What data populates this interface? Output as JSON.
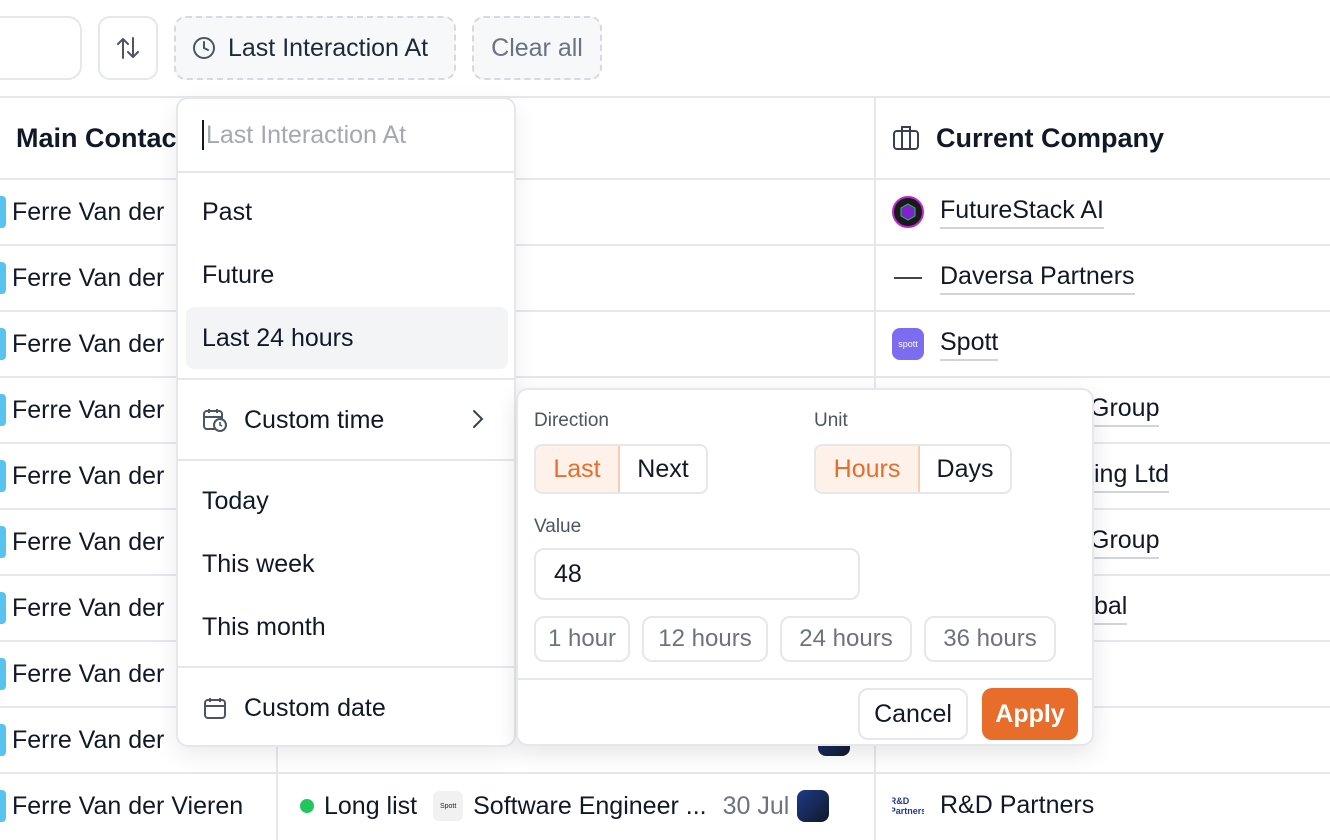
{
  "toolbar": {
    "sort_icon": "sort-arrows-icon",
    "filter_chip": {
      "icon": "clock-icon",
      "label": "Last Interaction At"
    },
    "clear_all_label": "Clear all"
  },
  "table": {
    "columns": {
      "contact": "Main Contac",
      "company": {
        "icon": "building-icon",
        "label": "Current Company"
      }
    },
    "rows": [
      {
        "contact": "Ferre Van der",
        "company": "FutureStack AI",
        "company_logo": "futurestack-logo"
      },
      {
        "contact": "Ferre Van der",
        "company": "Daversa Partners",
        "company_logo": "daversa-logo"
      },
      {
        "contact": "Ferre Van der",
        "company": "Spott",
        "company_logo": "spott-logo",
        "logo_text": "spott"
      },
      {
        "contact": "Ferre Van der",
        "company": "Group"
      },
      {
        "contact": "Ferre Van der",
        "company": "ing Ltd"
      },
      {
        "contact": "Ferre Van der",
        "company": "Group"
      },
      {
        "contact": "Ferre Van der",
        "company": "bal"
      },
      {
        "contact": "Ferre Van der",
        "company": ""
      },
      {
        "contact": "Ferre Van der",
        "company": ""
      },
      {
        "contact": "Ferre Van der Vieren",
        "stage": "Long list",
        "role_logo_text": "Spott",
        "role": "Software Engineer ...",
        "date": "30 Jul",
        "company": "R&D Partners",
        "company_logo": "rd-partners-logo",
        "logo_text": "R&D Partners"
      }
    ]
  },
  "menu": {
    "search_placeholder": "Last Interaction At",
    "items": {
      "past": "Past",
      "future": "Future",
      "last24": "Last 24 hours",
      "custom_time": "Custom time",
      "today": "Today",
      "this_week": "This week",
      "this_month": "This month",
      "custom_date": "Custom date"
    }
  },
  "custom_time_panel": {
    "direction_label": "Direction",
    "direction_options": [
      "Last",
      "Next"
    ],
    "direction_selected": "Last",
    "unit_label": "Unit",
    "unit_options": [
      "Hours",
      "Days"
    ],
    "unit_selected": "Hours",
    "value_label": "Value",
    "value": "48",
    "presets": [
      "1 hour",
      "12 hours",
      "24 hours",
      "36 hours"
    ],
    "cancel_label": "Cancel",
    "apply_label": "Apply",
    "accent_color": "#e86d2a"
  }
}
